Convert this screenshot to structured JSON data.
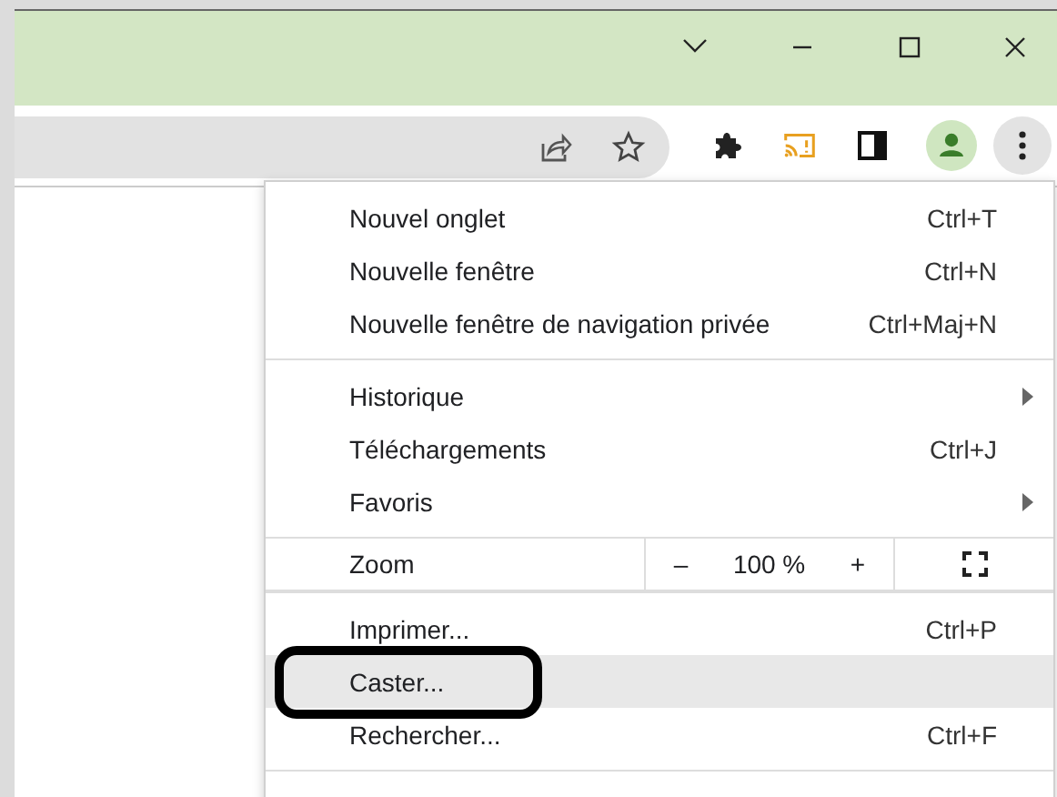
{
  "toolbar": {
    "menu_button_active": true
  },
  "menu": {
    "sections": [
      {
        "items": [
          {
            "kind": "item",
            "label": "Nouvel onglet",
            "shortcut": "Ctrl+T",
            "selected": false,
            "circled": false
          },
          {
            "kind": "item",
            "label": "Nouvelle fenêtre",
            "shortcut": "Ctrl+N",
            "selected": false,
            "circled": false
          },
          {
            "kind": "item",
            "label": "Nouvelle fenêtre de navigation privée",
            "shortcut": "Ctrl+Maj+N",
            "selected": false,
            "circled": false
          }
        ]
      },
      {
        "items": [
          {
            "kind": "submenu",
            "label": "Historique",
            "selected": false,
            "circled": false
          },
          {
            "kind": "item",
            "label": "Téléchargements",
            "shortcut": "Ctrl+J",
            "selected": false,
            "circled": false
          },
          {
            "kind": "submenu",
            "label": "Favoris",
            "selected": false,
            "circled": false
          }
        ]
      },
      {
        "items": [
          {
            "kind": "zoom",
            "label": "Zoom",
            "minus": "–",
            "value": "100 %",
            "plus": "+",
            "selected": false,
            "circled": false
          }
        ]
      },
      {
        "items": [
          {
            "kind": "item",
            "label": "Imprimer...",
            "shortcut": "Ctrl+P",
            "selected": false,
            "circled": false
          },
          {
            "kind": "item",
            "label": "Caster...",
            "selected": true,
            "circled": true
          },
          {
            "kind": "item",
            "label": "Rechercher...",
            "shortcut": "Ctrl+F",
            "selected": false,
            "circled": false
          }
        ]
      }
    ]
  }
}
